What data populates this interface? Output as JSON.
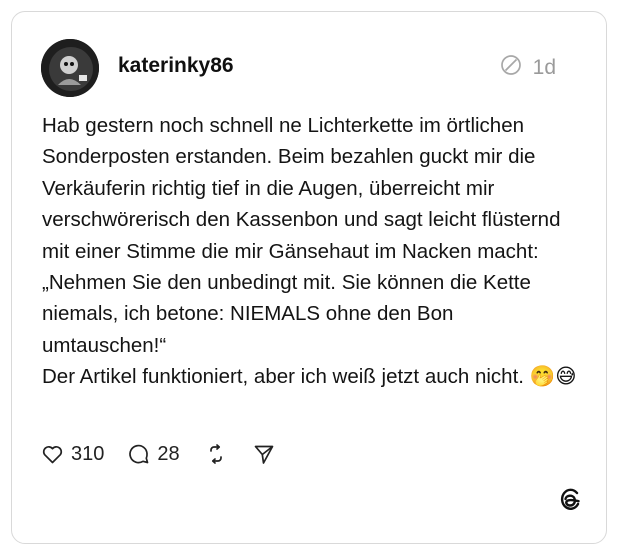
{
  "post": {
    "username": "katerinky86",
    "time": "1d",
    "text_main": "Hab gestern noch schnell ne Lichterkette im örtlichen Sonderposten erstanden. Beim bezahlen guckt mir die Verkäuferin richtig tief in die Augen, überreicht mir verschwörerisch den Kassenbon und sagt leicht flüsternd mit einer Stimme die mir Gänsehaut im Nacken macht: „Nehmen Sie den unbedingt mit. Sie können die Kette niemals, ich betone: NIEMALS ohne den Bon umtauschen!“\nDer Artikel funktioniert, aber ich weiß jetzt auch nicht.",
    "emojis": "🤭😅",
    "likes": "310",
    "replies": "28"
  },
  "icons": {
    "time_status": "circle-slash-icon",
    "like": "heart-icon",
    "reply": "comment-icon",
    "repost": "repost-icon",
    "share": "send-icon",
    "app": "threads-logo-icon"
  },
  "colors": {
    "text": "#141414",
    "muted": "#9a9a9a",
    "border": "#d9d9d9"
  }
}
